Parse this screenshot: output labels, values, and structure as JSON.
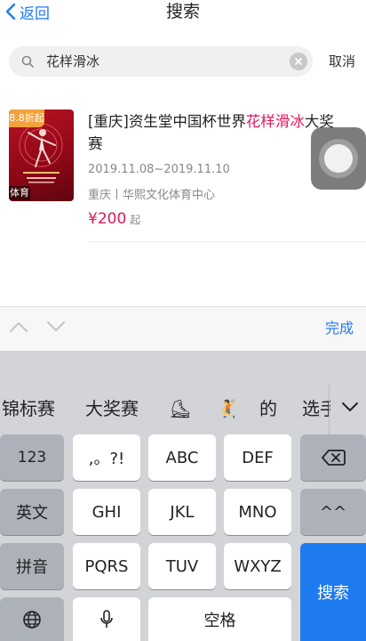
{
  "nav": {
    "back_label": "返回",
    "title": "搜索"
  },
  "search": {
    "query": "花样滑冰",
    "cancel_label": "取消"
  },
  "result": {
    "discount": "8.8折起",
    "category_tag": "体育",
    "title_prefix": "[重庆]资生堂中国杯世界",
    "title_highlight": "花样滑冰",
    "title_suffix": "大奖赛",
    "dates": "2019.11.08~2019.11.10",
    "venue": "重庆丨华熙文化体育中心",
    "price": "¥200",
    "price_suffix": "起"
  },
  "accessory": {
    "done_label": "完成"
  },
  "candidates": [
    "锦标赛",
    "大奖赛",
    "⛸",
    "🤾",
    "的",
    "选手"
  ],
  "keyboard": {
    "row1": [
      "123",
      ",。?!",
      "ABC",
      "DEF"
    ],
    "row2": [
      "英文",
      "GHI",
      "JKL",
      "MNO",
      "^^"
    ],
    "row3": [
      "拼音",
      "PQRS",
      "TUV",
      "WXYZ"
    ],
    "search_label": "搜索",
    "space_label": "空格"
  },
  "colors": {
    "accent": "#1e7bf0",
    "highlight": "#e0165e"
  }
}
